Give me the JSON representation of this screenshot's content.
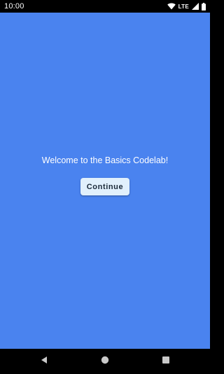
{
  "status_bar": {
    "time": "10:00",
    "network": "LTE",
    "icons": [
      "wifi-icon",
      "signal-icon",
      "battery-icon"
    ]
  },
  "main": {
    "welcome_text": "Welcome to the Basics Codelab!",
    "continue_label": "Continue",
    "background_color": "#4a83ef",
    "button_color": "#e1f0fc"
  },
  "nav_bar": {
    "icons": [
      "back-icon",
      "home-icon",
      "recents-icon"
    ]
  }
}
